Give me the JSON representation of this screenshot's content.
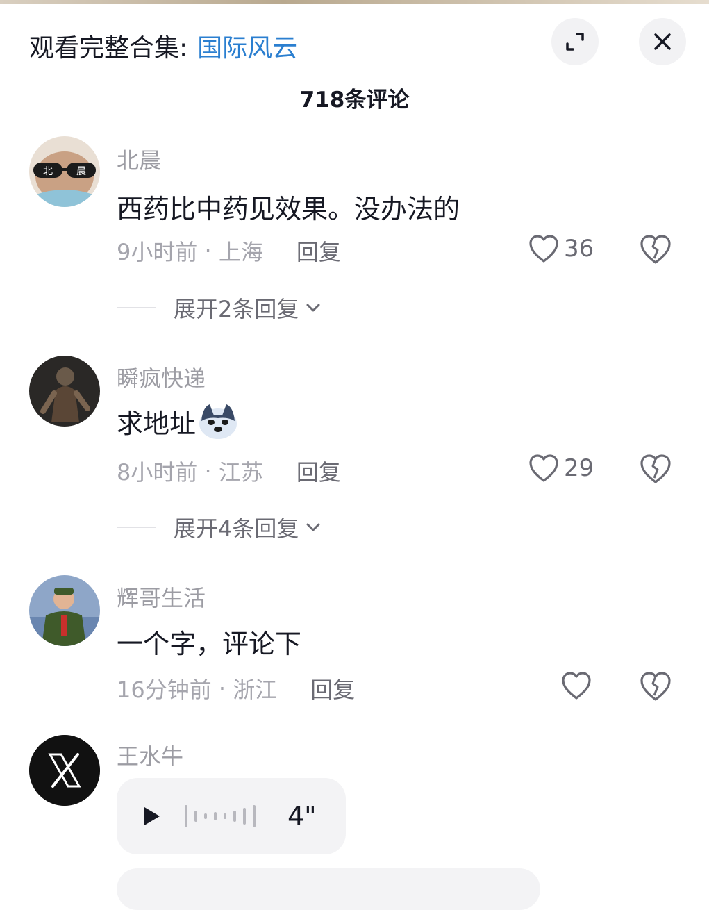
{
  "header": {
    "prefix": "观看完整合集:",
    "collection_link": "国际风云",
    "expand_icon": "expand-icon",
    "close_icon": "close-icon"
  },
  "comment_count": "718条评论",
  "comments": [
    {
      "username": "北晨",
      "text": "西药比中药见效果。没办法的",
      "time": "9小时前",
      "location": "上海",
      "reply_label": "回复",
      "likes": "36",
      "expand_label": "展开2条回复",
      "avatar_label_left": "北",
      "avatar_label_right": "晨"
    },
    {
      "username": "瞬疯快递",
      "text": "求地址",
      "emoji": "husky-emoji",
      "time": "8小时前",
      "location": "江苏",
      "reply_label": "回复",
      "likes": "29",
      "expand_label": "展开4条回复"
    },
    {
      "username": "辉哥生活",
      "text": "一个字，评论下",
      "time": "16分钟前",
      "location": "浙江",
      "reply_label": "回复",
      "likes": ""
    },
    {
      "username": "王水牛",
      "voice_duration": "4\""
    }
  ],
  "colors": {
    "link": "#2b7fd0",
    "muted": "#a5a5ad",
    "text": "#161823"
  }
}
